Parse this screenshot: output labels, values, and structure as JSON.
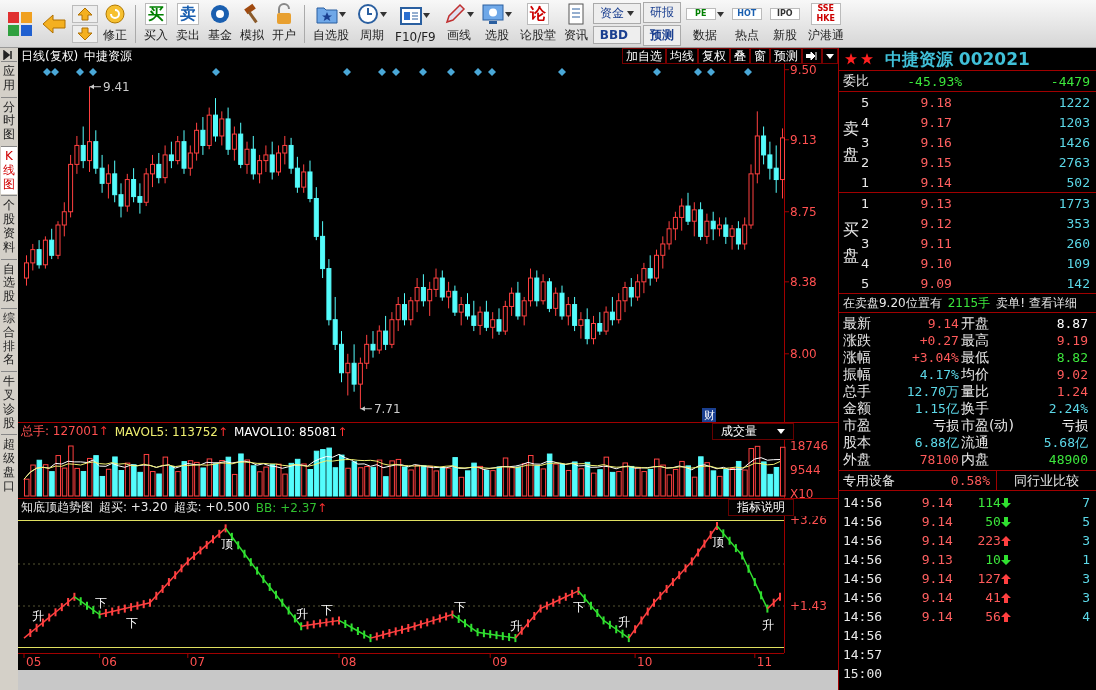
{
  "toolbar": [
    {
      "label": "修正",
      "dropdown": false
    },
    {
      "label": "买入",
      "glyph": "买",
      "dropdown": false
    },
    {
      "label": "卖出",
      "glyph": "卖",
      "dropdown": false
    },
    {
      "label": "基金",
      "dropdown": false
    },
    {
      "label": "模拟",
      "dropdown": false
    },
    {
      "label": "开户",
      "dropdown": false
    },
    {
      "label": "自选股",
      "dropdown": true
    },
    {
      "label": "周期",
      "dropdown": true
    },
    {
      "label": "F10/F9",
      "dropdown": true
    },
    {
      "label": "画线",
      "dropdown": true
    },
    {
      "label": "选股",
      "dropdown": true
    },
    {
      "label": "论股堂",
      "glyph": "论",
      "dropdown": false
    },
    {
      "label": "资讯",
      "dropdown": false
    },
    {
      "kind": "pair",
      "top": "资金",
      "bottom": "BBD",
      "dropdown": true
    },
    {
      "kind": "pair",
      "top": "研报",
      "bottom": "预测",
      "dropdown": false
    },
    {
      "label": "数据",
      "glyph": "PE",
      "dropdown": true
    },
    {
      "label": "热点",
      "glyph": "HOT",
      "dropdown": false
    },
    {
      "label": "新股",
      "glyph": "IPO",
      "dropdown": false
    },
    {
      "label": "沪港通",
      "glyph": "SSE HKE",
      "dropdown": false
    }
  ],
  "side_tabs": [
    {
      "label": "应用",
      "selected": false
    },
    {
      "label": "分时图",
      "selected": false
    },
    {
      "label": "K线图",
      "selected": true
    },
    {
      "label": "个股资料",
      "selected": false
    },
    {
      "label": "自选股",
      "selected": false
    },
    {
      "label": "综合排名",
      "selected": false
    },
    {
      "label": "牛叉诊股",
      "selected": false
    },
    {
      "label": "超级盘口",
      "selected": false
    }
  ],
  "chart_header": {
    "period": "日线(复权)",
    "stock": "中捷资源",
    "buttons": [
      "加自选",
      "均线",
      "复权",
      "叠",
      "窗",
      "预测"
    ]
  },
  "price_panel": {
    "high_label": "9.41",
    "low_label": "7.71",
    "event_marker": "财",
    "chart_data": {
      "type": "candlestick",
      "ohlc": [
        [
          8.4,
          8.52,
          8.36,
          8.48
        ],
        [
          8.48,
          8.58,
          8.44,
          8.55
        ],
        [
          8.55,
          8.6,
          8.45,
          8.47
        ],
        [
          8.47,
          8.62,
          8.45,
          8.6
        ],
        [
          8.6,
          8.66,
          8.5,
          8.52
        ],
        [
          8.52,
          8.7,
          8.5,
          8.68
        ],
        [
          8.68,
          8.8,
          8.62,
          8.75
        ],
        [
          8.75,
          9.05,
          8.72,
          9.0
        ],
        [
          9.0,
          9.15,
          8.95,
          9.1
        ],
        [
          9.1,
          9.2,
          8.98,
          9.02
        ],
        [
          9.02,
          9.41,
          8.96,
          9.12
        ],
        [
          9.12,
          9.18,
          8.95,
          8.98
        ],
        [
          8.98,
          9.05,
          8.85,
          8.9
        ],
        [
          8.9,
          9.0,
          8.82,
          8.95
        ],
        [
          8.95,
          9.02,
          8.8,
          8.84
        ],
        [
          8.84,
          8.9,
          8.72,
          8.78
        ],
        [
          8.78,
          8.95,
          8.75,
          8.92
        ],
        [
          8.92,
          8.98,
          8.8,
          8.83
        ],
        [
          8.83,
          8.9,
          8.74,
          8.8
        ],
        [
          8.8,
          8.98,
          8.78,
          8.95
        ],
        [
          8.95,
          9.05,
          8.88,
          9.0
        ],
        [
          9.0,
          9.06,
          8.9,
          8.93
        ],
        [
          8.93,
          9.1,
          8.9,
          9.05
        ],
        [
          9.05,
          9.12,
          8.98,
          9.02
        ],
        [
          9.02,
          9.15,
          9.0,
          9.12
        ],
        [
          9.12,
          9.18,
          8.95,
          8.98
        ],
        [
          8.98,
          9.1,
          8.94,
          9.06
        ],
        [
          9.06,
          9.22,
          9.02,
          9.18
        ],
        [
          9.18,
          9.25,
          9.05,
          9.1
        ],
        [
          9.1,
          9.3,
          9.08,
          9.26
        ],
        [
          9.26,
          9.35,
          9.12,
          9.15
        ],
        [
          9.15,
          9.28,
          9.1,
          9.24
        ],
        [
          9.24,
          9.3,
          9.05,
          9.08
        ],
        [
          9.08,
          9.2,
          9.02,
          9.16
        ],
        [
          9.16,
          9.22,
          8.98,
          9.0
        ],
        [
          9.0,
          9.12,
          8.95,
          9.08
        ],
        [
          9.08,
          9.15,
          8.92,
          8.95
        ],
        [
          8.95,
          9.05,
          8.9,
          9.02
        ],
        [
          9.02,
          9.1,
          8.96,
          9.05
        ],
        [
          9.05,
          9.12,
          8.92,
          8.96
        ],
        [
          8.96,
          9.1,
          8.94,
          9.06
        ],
        [
          9.06,
          9.15,
          9.0,
          9.1
        ],
        [
          9.1,
          9.14,
          8.95,
          8.98
        ],
        [
          8.98,
          9.04,
          8.85,
          8.88
        ],
        [
          8.88,
          9.0,
          8.85,
          8.96
        ],
        [
          8.96,
          9.02,
          8.8,
          8.82
        ],
        [
          8.82,
          8.88,
          8.6,
          8.62
        ],
        [
          8.62,
          8.7,
          8.4,
          8.45
        ],
        [
          8.45,
          8.5,
          8.15,
          8.18
        ],
        [
          8.18,
          8.3,
          8.02,
          8.05
        ],
        [
          8.05,
          8.12,
          7.85,
          7.9
        ],
        [
          7.9,
          8.0,
          7.78,
          7.95
        ],
        [
          7.95,
          8.05,
          7.8,
          7.84
        ],
        [
          7.84,
          7.98,
          7.71,
          7.95
        ],
        [
          7.95,
          8.1,
          7.92,
          8.05
        ],
        [
          8.05,
          8.12,
          7.98,
          8.02
        ],
        [
          8.02,
          8.15,
          8.0,
          8.12
        ],
        [
          8.12,
          8.2,
          8.02,
          8.05
        ],
        [
          8.05,
          8.22,
          8.03,
          8.18
        ],
        [
          8.18,
          8.3,
          8.12,
          8.26
        ],
        [
          8.26,
          8.32,
          8.15,
          8.18
        ],
        [
          8.18,
          8.3,
          8.15,
          8.28
        ],
        [
          8.28,
          8.4,
          8.22,
          8.35
        ],
        [
          8.35,
          8.42,
          8.25,
          8.28
        ],
        [
          8.28,
          8.38,
          8.2,
          8.34
        ],
        [
          8.34,
          8.45,
          8.3,
          8.4
        ],
        [
          8.4,
          8.44,
          8.28,
          8.3
        ],
        [
          8.3,
          8.38,
          8.24,
          8.33
        ],
        [
          8.33,
          8.36,
          8.2,
          8.22
        ],
        [
          8.22,
          8.3,
          8.15,
          8.26
        ],
        [
          8.26,
          8.32,
          8.18,
          8.2
        ],
        [
          8.2,
          8.28,
          8.12,
          8.15
        ],
        [
          8.15,
          8.25,
          8.1,
          8.22
        ],
        [
          8.22,
          8.28,
          8.12,
          8.14
        ],
        [
          8.14,
          8.22,
          8.08,
          8.18
        ],
        [
          8.18,
          8.24,
          8.1,
          8.12
        ],
        [
          8.12,
          8.28,
          8.1,
          8.25
        ],
        [
          8.25,
          8.35,
          8.2,
          8.32
        ],
        [
          8.32,
          8.38,
          8.18,
          8.2
        ],
        [
          8.2,
          8.3,
          8.15,
          8.28
        ],
        [
          8.28,
          8.45,
          8.25,
          8.4
        ],
        [
          8.4,
          8.44,
          8.25,
          8.28
        ],
        [
          8.28,
          8.42,
          8.26,
          8.38
        ],
        [
          8.38,
          8.4,
          8.22,
          8.24
        ],
        [
          8.24,
          8.35,
          8.2,
          8.32
        ],
        [
          8.32,
          8.36,
          8.18,
          8.2
        ],
        [
          8.2,
          8.3,
          8.15,
          8.26
        ],
        [
          8.26,
          8.3,
          8.12,
          8.15
        ],
        [
          8.15,
          8.22,
          8.08,
          8.18
        ],
        [
          8.18,
          8.24,
          8.05,
          8.08
        ],
        [
          8.08,
          8.2,
          8.05,
          8.16
        ],
        [
          8.16,
          8.22,
          8.1,
          8.12
        ],
        [
          8.12,
          8.25,
          8.1,
          8.22
        ],
        [
          8.22,
          8.3,
          8.15,
          8.18
        ],
        [
          8.18,
          8.32,
          8.16,
          8.28
        ],
        [
          8.28,
          8.38,
          8.22,
          8.35
        ],
        [
          8.35,
          8.4,
          8.25,
          8.3
        ],
        [
          8.3,
          8.42,
          8.28,
          8.38
        ],
        [
          8.38,
          8.48,
          8.32,
          8.45
        ],
        [
          8.45,
          8.52,
          8.36,
          8.4
        ],
        [
          8.4,
          8.55,
          8.38,
          8.52
        ],
        [
          8.52,
          8.62,
          8.45,
          8.58
        ],
        [
          8.58,
          8.7,
          8.55,
          8.66
        ],
        [
          8.66,
          8.75,
          8.6,
          8.72
        ],
        [
          8.72,
          8.82,
          8.65,
          8.78
        ],
        [
          8.78,
          8.85,
          8.68,
          8.7
        ],
        [
          8.7,
          8.8,
          8.62,
          8.76
        ],
        [
          8.76,
          8.8,
          8.6,
          8.62
        ],
        [
          8.62,
          8.74,
          8.58,
          8.7
        ],
        [
          8.7,
          8.75,
          8.6,
          8.66
        ],
        [
          8.66,
          8.72,
          8.62,
          8.68
        ],
        [
          8.68,
          8.72,
          8.58,
          8.62
        ],
        [
          8.62,
          8.68,
          8.55,
          8.66
        ],
        [
          8.66,
          8.7,
          8.55,
          8.58
        ],
        [
          8.58,
          8.72,
          8.55,
          8.68
        ],
        [
          8.68,
          9.0,
          8.66,
          8.95
        ],
        [
          8.95,
          9.28,
          8.9,
          9.15
        ],
        [
          9.15,
          9.2,
          9.0,
          9.05
        ],
        [
          9.05,
          9.12,
          8.92,
          8.98
        ],
        [
          8.98,
          9.1,
          8.85,
          8.92
        ],
        [
          8.92,
          9.19,
          8.82,
          9.14
        ]
      ],
      "ylim": [
        7.64,
        9.53
      ],
      "yticks": [
        {
          "value": 9.5,
          "label": "9.50"
        },
        {
          "value": 9.13,
          "label": "9.13"
        },
        {
          "value": 8.75,
          "label": "8.75"
        },
        {
          "value": 8.38,
          "label": "8.38"
        },
        {
          "value": 8.0,
          "label": "8.00"
        }
      ]
    }
  },
  "x_axis": [
    "05",
    "06",
    "07",
    "08",
    "09",
    "10",
    "11"
  ],
  "volume_panel": {
    "legend": [
      {
        "text": "总手: 127001",
        "arrow": "↑",
        "color": "#ff5050"
      },
      {
        "text": "MAVOL5: 113752",
        "arrow": "↑",
        "color": "#f0f070"
      },
      {
        "text": "MAVOL10: 85081",
        "arrow": "↑",
        "color": "#ffffff"
      }
    ],
    "selector": "成交量",
    "yticks": [
      "18746",
      "9544",
      "X10"
    ]
  },
  "indicator_panel": {
    "legend": [
      {
        "text": "知底顶趋势图"
      },
      {
        "text": "超买: +3.20"
      },
      {
        "text": "超卖: +0.500"
      },
      {
        "text": "BB: +2.37",
        "arrow": "↑",
        "color": "#30c030"
      }
    ],
    "help_button": "指标说明",
    "yticks": [
      "+3.26",
      "+1.43"
    ],
    "signals": [
      "升",
      "下",
      "下",
      "顶",
      "升",
      "下",
      "下",
      "升",
      "下",
      "升",
      "顶",
      "升"
    ]
  },
  "quote_panel": {
    "title": "中捷资源 002021",
    "ratio": {
      "label": "委比",
      "percent": "-45.93%",
      "amount": "-4479"
    },
    "sell": {
      "label": "卖盘",
      "rows": [
        {
          "level": "5",
          "price": "9.18",
          "volume": "1222"
        },
        {
          "level": "4",
          "price": "9.17",
          "volume": "1203"
        },
        {
          "level": "3",
          "price": "9.16",
          "volume": "1426"
        },
        {
          "level": "2",
          "price": "9.15",
          "volume": "2763"
        },
        {
          "level": "1",
          "price": "9.14",
          "volume": "502"
        }
      ]
    },
    "buy": {
      "label": "买盘",
      "rows": [
        {
          "level": "1",
          "price": "9.13",
          "volume": "1773"
        },
        {
          "level": "2",
          "price": "9.12",
          "volume": "353"
        },
        {
          "level": "3",
          "price": "9.11",
          "volume": "260"
        },
        {
          "level": "4",
          "price": "9.10",
          "volume": "109"
        },
        {
          "level": "5",
          "price": "9.09",
          "volume": "142"
        }
      ]
    },
    "notice": {
      "text": "在卖盘9.20位置有",
      "amount": "2115手",
      "link": "卖单! 查看详细"
    },
    "stats": [
      {
        "l": {
          "label": "最新",
          "value": "9.14",
          "kind": "up"
        },
        "r": {
          "label": "开盘",
          "value": "8.87",
          "kind": "neutral"
        }
      },
      {
        "l": {
          "label": "涨跌",
          "value": "+0.27",
          "kind": "up"
        },
        "r": {
          "label": "最高",
          "value": "9.19",
          "kind": "up"
        }
      },
      {
        "l": {
          "label": "涨幅",
          "value": "+3.04%",
          "kind": "up"
        },
        "r": {
          "label": "最低",
          "value": "8.82",
          "kind": "down"
        }
      },
      {
        "l": {
          "label": "振幅",
          "value": "4.17%",
          "kind": "info"
        },
        "r": {
          "label": "均价",
          "value": "9.02",
          "kind": "up"
        }
      },
      {
        "l": {
          "label": "总手",
          "value": "12.70万",
          "kind": "info"
        },
        "r": {
          "label": "量比",
          "value": "1.24",
          "kind": "up"
        }
      },
      {
        "l": {
          "label": "金额",
          "value": "1.15亿",
          "kind": "info"
        },
        "r": {
          "label": "换手",
          "value": "2.24%",
          "kind": "info"
        }
      },
      {
        "l": {
          "label": "市盈",
          "value": "亏损",
          "kind": "neutral"
        },
        "r": {
          "label": "市盈(动)",
          "value": "亏损",
          "kind": "neutral"
        }
      },
      {
        "l": {
          "label": "股本",
          "value": "6.88亿",
          "kind": "info"
        },
        "r": {
          "label": "流通",
          "value": "5.68亿",
          "kind": "info"
        }
      },
      {
        "l": {
          "label": "外盘",
          "value": "78100",
          "kind": "up"
        },
        "r": {
          "label": "内盘",
          "value": "48900",
          "kind": "down"
        }
      }
    ],
    "industry": {
      "name": "专用设备",
      "change": "0.58%",
      "button": "同行业比较"
    },
    "ticks": [
      {
        "time": "14:56",
        "price": "9.14",
        "volume": "114",
        "up": false,
        "count": "7"
      },
      {
        "time": "14:56",
        "price": "9.14",
        "volume": "50",
        "up": false,
        "count": "5"
      },
      {
        "time": "14:56",
        "price": "9.14",
        "volume": "223",
        "up": true,
        "count": "3"
      },
      {
        "time": "14:56",
        "price": "9.13",
        "volume": "10",
        "up": false,
        "count": "1"
      },
      {
        "time": "14:56",
        "price": "9.14",
        "volume": "127",
        "up": true,
        "count": "3"
      },
      {
        "time": "14:56",
        "price": "9.14",
        "volume": "41",
        "up": true,
        "count": "3"
      },
      {
        "time": "14:56",
        "price": "9.14",
        "volume": "56",
        "up": true,
        "count": "4"
      },
      {
        "time": "14:56"
      },
      {
        "time": "14:57"
      },
      {
        "time": "15:00"
      }
    ]
  }
}
